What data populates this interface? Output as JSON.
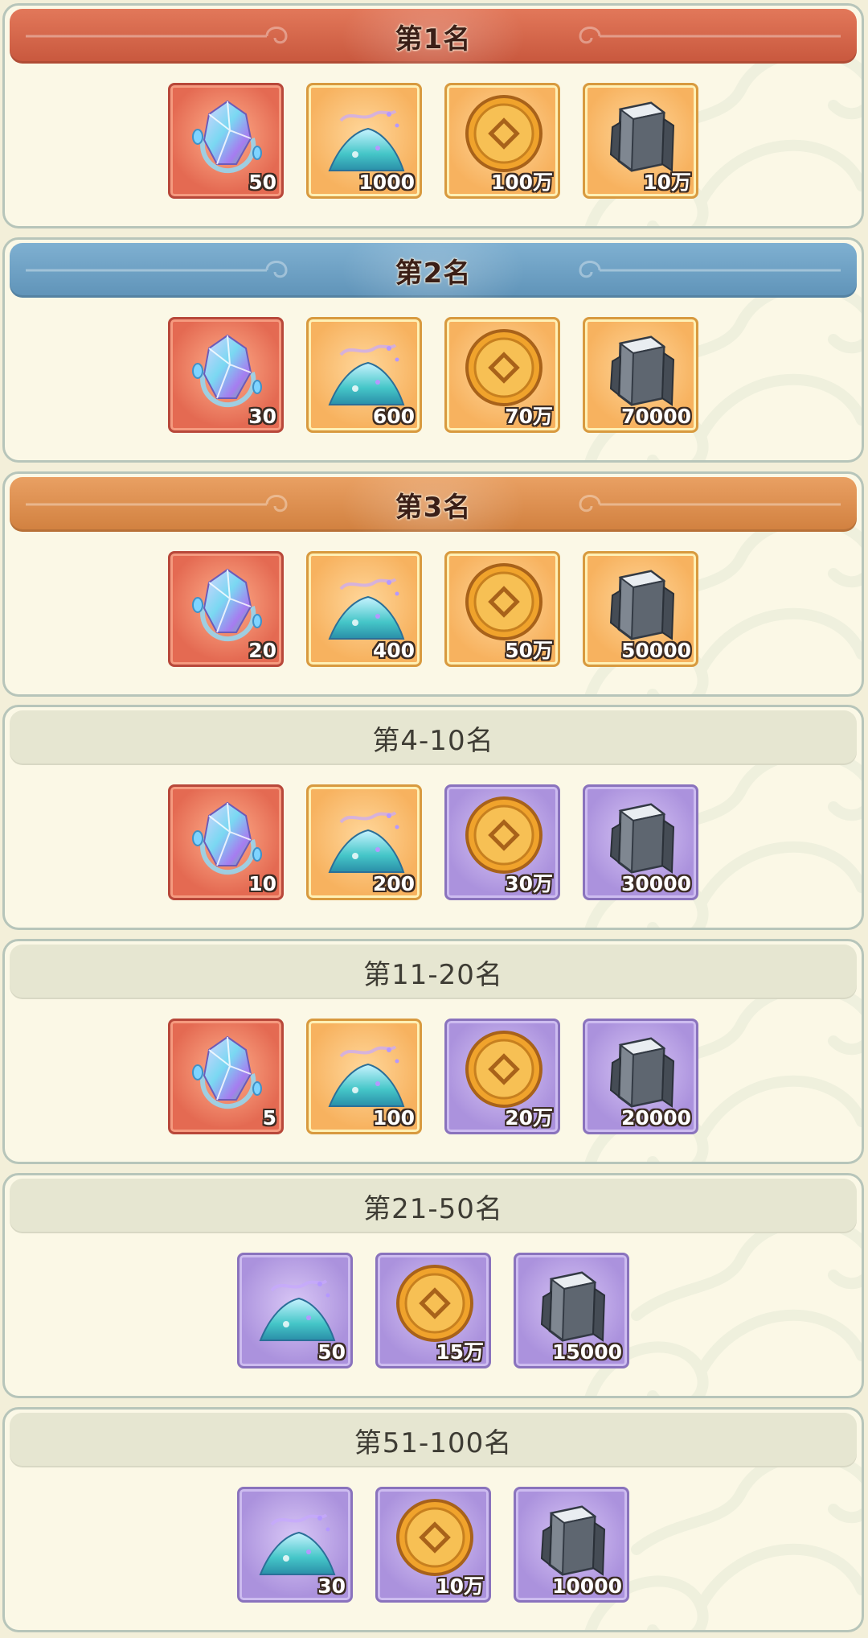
{
  "reward_tiers": [
    {
      "title": "第1名",
      "style": "rank-1",
      "items": [
        {
          "icon": "crystal-egg-icon",
          "quality": "red",
          "count": "50"
        },
        {
          "icon": "spirit-dust-icon",
          "quality": "orange",
          "count": "1000"
        },
        {
          "icon": "copper-coin-icon",
          "quality": "orange",
          "count": "100万"
        },
        {
          "icon": "iron-ore-icon",
          "quality": "orange",
          "count": "10万"
        }
      ]
    },
    {
      "title": "第2名",
      "style": "rank-2",
      "items": [
        {
          "icon": "crystal-egg-icon",
          "quality": "red",
          "count": "30"
        },
        {
          "icon": "spirit-dust-icon",
          "quality": "orange",
          "count": "600"
        },
        {
          "icon": "copper-coin-icon",
          "quality": "orange",
          "count": "70万"
        },
        {
          "icon": "iron-ore-icon",
          "quality": "orange",
          "count": "70000"
        }
      ]
    },
    {
      "title": "第3名",
      "style": "rank-3",
      "items": [
        {
          "icon": "crystal-egg-icon",
          "quality": "red",
          "count": "20"
        },
        {
          "icon": "spirit-dust-icon",
          "quality": "orange",
          "count": "400"
        },
        {
          "icon": "copper-coin-icon",
          "quality": "orange",
          "count": "50万"
        },
        {
          "icon": "iron-ore-icon",
          "quality": "orange",
          "count": "50000"
        }
      ]
    },
    {
      "title": "第4-10名",
      "style": "plain",
      "items": [
        {
          "icon": "crystal-egg-icon",
          "quality": "red",
          "count": "10"
        },
        {
          "icon": "spirit-dust-icon",
          "quality": "orange",
          "count": "200"
        },
        {
          "icon": "copper-coin-icon",
          "quality": "purple",
          "count": "30万"
        },
        {
          "icon": "iron-ore-icon",
          "quality": "purple",
          "count": "30000"
        }
      ]
    },
    {
      "title": "第11-20名",
      "style": "plain",
      "items": [
        {
          "icon": "crystal-egg-icon",
          "quality": "red",
          "count": "5"
        },
        {
          "icon": "spirit-dust-icon",
          "quality": "orange",
          "count": "100"
        },
        {
          "icon": "copper-coin-icon",
          "quality": "purple",
          "count": "20万"
        },
        {
          "icon": "iron-ore-icon",
          "quality": "purple",
          "count": "20000"
        }
      ]
    },
    {
      "title": "第21-50名",
      "style": "plain",
      "items": [
        {
          "icon": "spirit-dust-icon",
          "quality": "purple",
          "count": "50"
        },
        {
          "icon": "copper-coin-icon",
          "quality": "purple",
          "count": "15万"
        },
        {
          "icon": "iron-ore-icon",
          "quality": "purple",
          "count": "15000"
        }
      ]
    },
    {
      "title": "第51-100名",
      "style": "plain",
      "items": [
        {
          "icon": "spirit-dust-icon",
          "quality": "purple",
          "count": "30"
        },
        {
          "icon": "copper-coin-icon",
          "quality": "purple",
          "count": "10万"
        },
        {
          "icon": "iron-ore-icon",
          "quality": "purple",
          "count": "10000"
        }
      ]
    }
  ]
}
